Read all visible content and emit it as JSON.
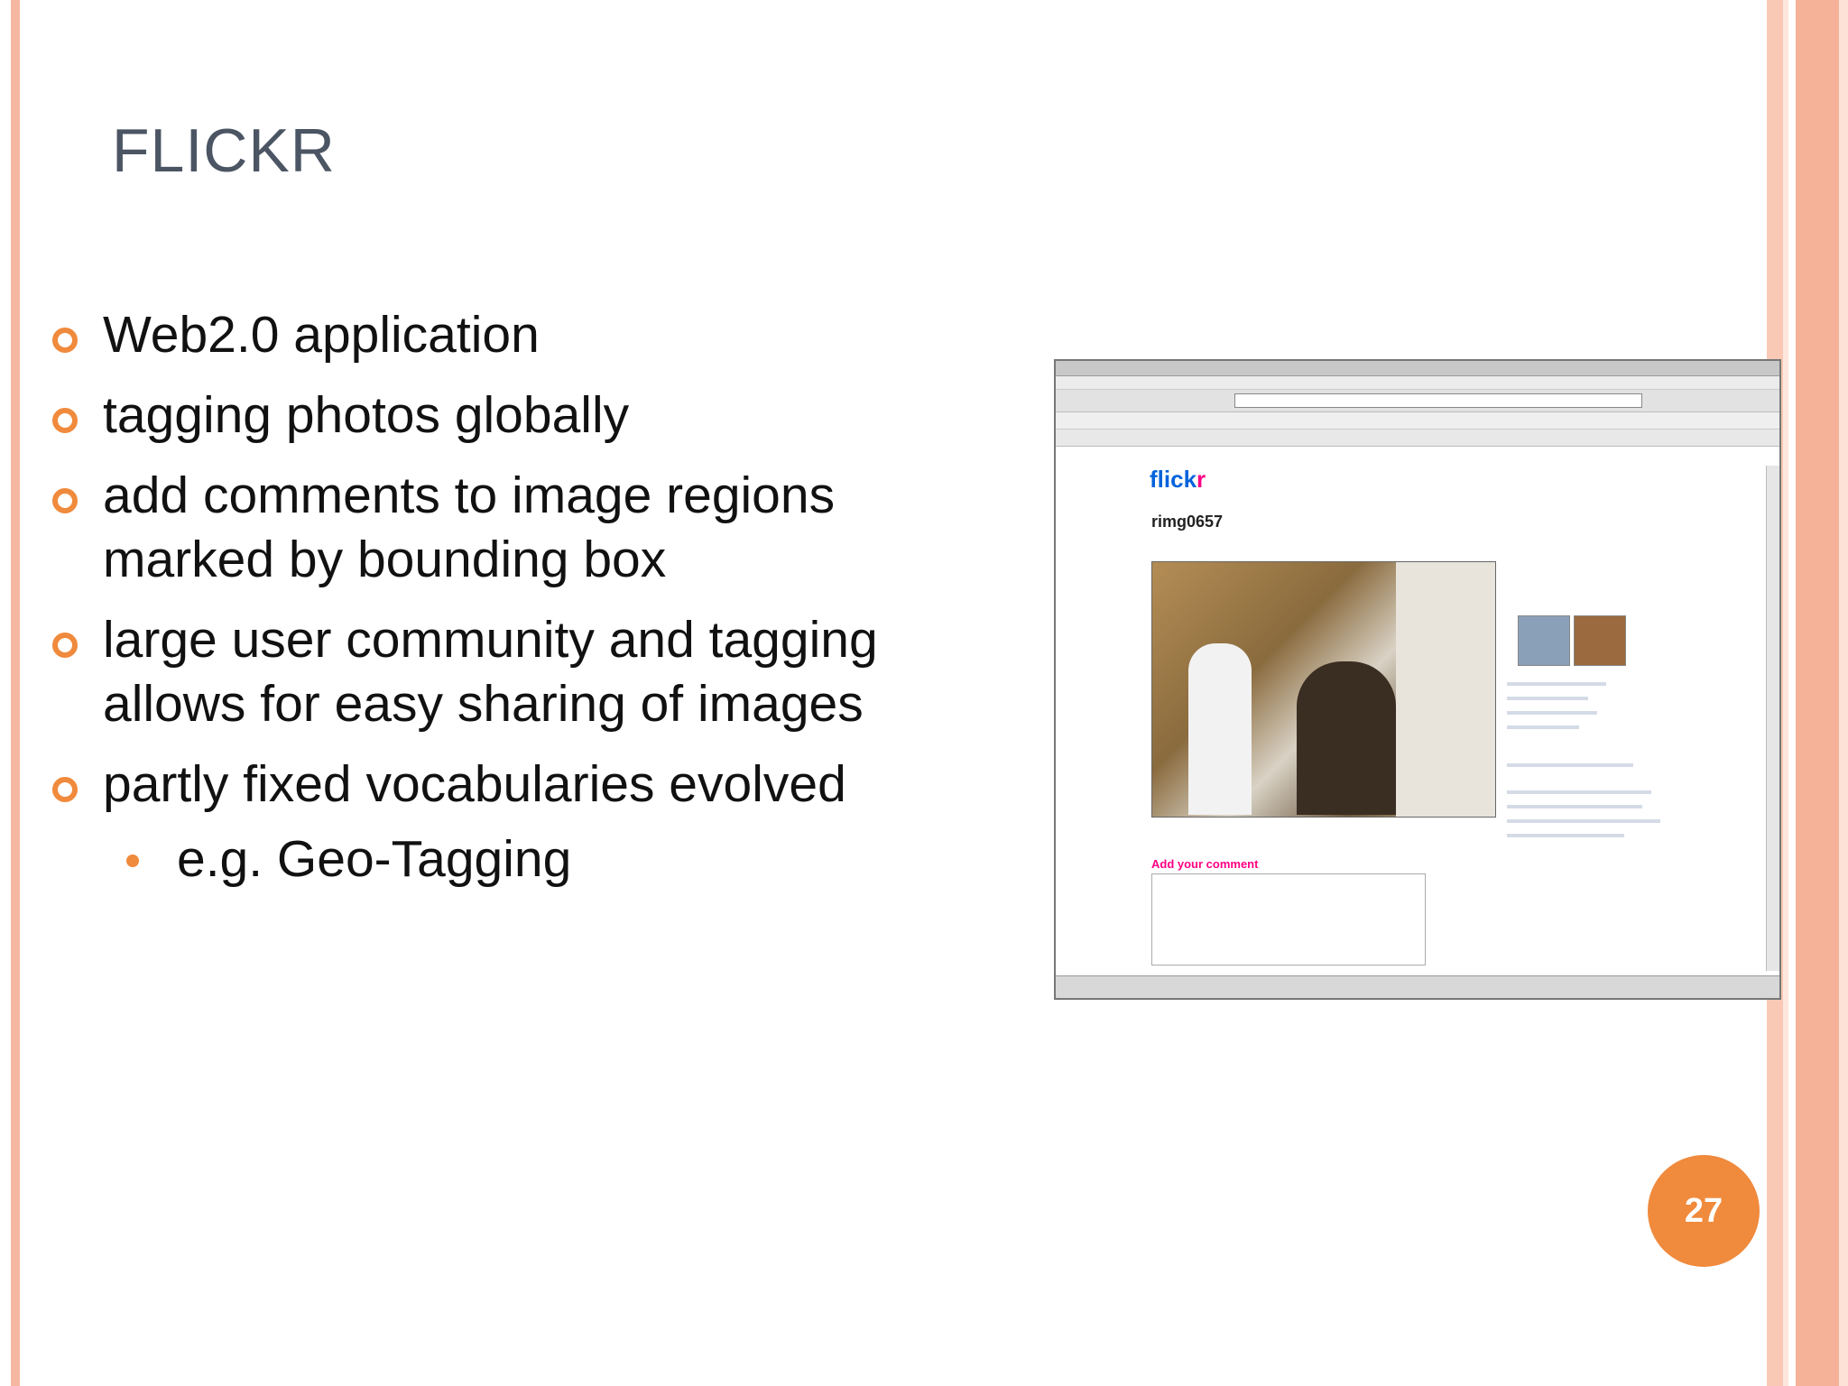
{
  "slide": {
    "title": "FLICKR",
    "bullets": [
      {
        "text": "Web2.0 application"
      },
      {
        "text": "tagging photos globally"
      },
      {
        "text": "add comments to image regions marked by  bounding box"
      },
      {
        "text": "large user community and tagging allows for easy sharing of images"
      },
      {
        "text": "partly fixed vocabularies evolved"
      }
    ],
    "sub_bullets": [
      {
        "text": "e.g. Geo-Tagging"
      }
    ],
    "page_number": "27"
  },
  "screenshot": {
    "logo_text": "flick",
    "logo_accent": "r",
    "photo_title": "rimg0657",
    "comment_label": "Add your comment"
  },
  "colors": {
    "accent": "#f08a3c",
    "stripe": "#f6b7a0",
    "title": "#4b5563",
    "flickr_blue": "#0063dc",
    "flickr_pink": "#ff0084"
  }
}
